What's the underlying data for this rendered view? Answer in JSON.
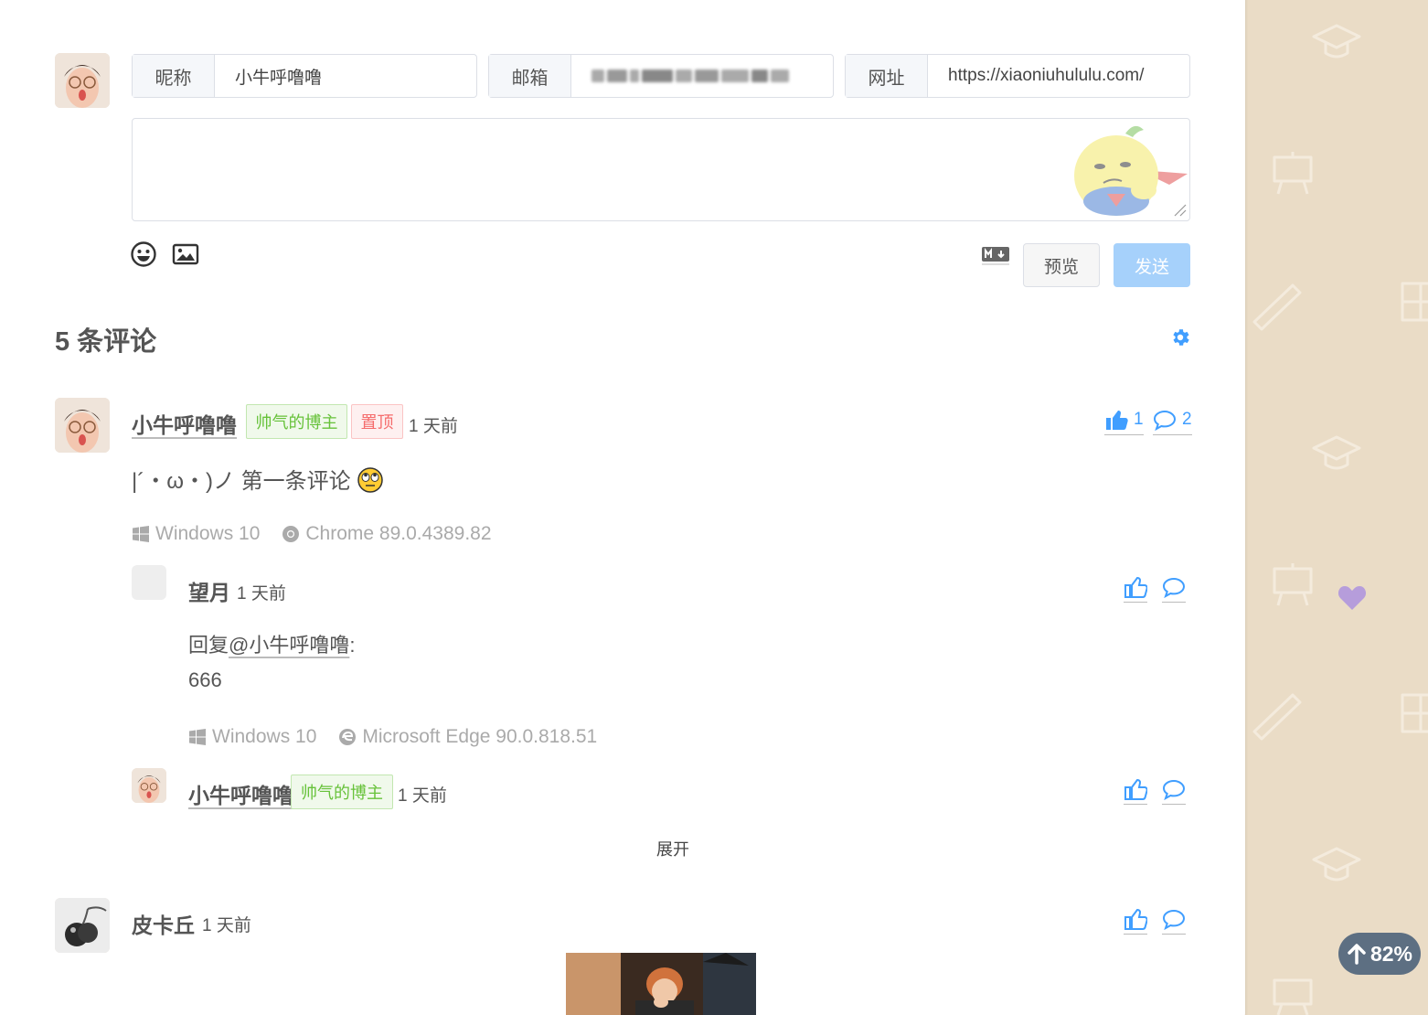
{
  "editor": {
    "nickname": {
      "label": "昵称",
      "value": "小牛呼噜噜"
    },
    "email": {
      "label": "邮箱"
    },
    "website": {
      "label": "网址",
      "value": "https://xiaoniuhululu.com/"
    },
    "preview_label": "预览",
    "send_label": "发送",
    "icons": [
      "emoji-icon",
      "image-icon",
      "markdown-icon"
    ]
  },
  "comments_header": {
    "count_text": "5 条评论"
  },
  "comments": [
    {
      "nick": "小牛呼噜噜",
      "badges": [
        "帅气的博主",
        "置顶"
      ],
      "time": "1 天前",
      "likes": "1",
      "replies": "2",
      "content": "|´・ω・)ノ 第一条评论",
      "os": "Windows 10",
      "browser": "Chrome 89.0.4389.82",
      "children": [
        {
          "nick": "望月",
          "time": "1 天前",
          "reply_prefix": "回复",
          "reply_to": "@小牛呼噜噜",
          "reply_suffix": ":",
          "content": "666",
          "os": "Windows 10",
          "browser": "Microsoft Edge 90.0.818.51"
        },
        {
          "nick": "小牛呼噜噜",
          "badge": "帅气的博主",
          "time": "1 天前"
        }
      ],
      "expand_label": "展开"
    },
    {
      "nick": "皮卡丘",
      "time": "1 天前"
    }
  ],
  "scroll": {
    "percent_label": "82%",
    "percent": 82
  },
  "colors": {
    "accent": "#409eff",
    "send_disabled": "#a6d1fb",
    "badge_green": "#67c23a",
    "badge_red": "#f56c6c",
    "side_bg": "#eadcc6",
    "progress_pill": "#5d6f82"
  }
}
